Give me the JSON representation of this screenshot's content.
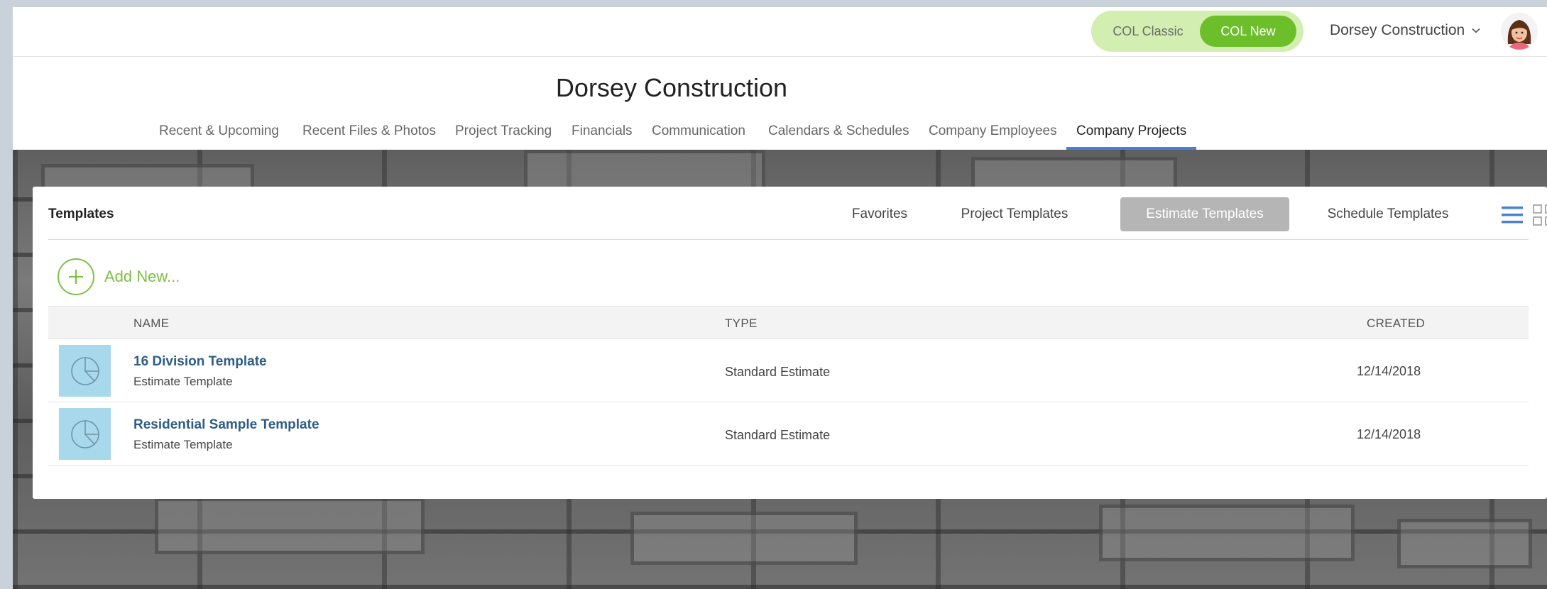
{
  "topbar": {
    "toggle": {
      "classic_label": "COL Classic",
      "new_label": "COL New",
      "selected": "COL New"
    },
    "company_menu": {
      "label": "Dorsey Construction",
      "icon": "chevron-down-icon"
    },
    "avatar_icon": "user-avatar"
  },
  "header": {
    "title": "Dorsey Construction",
    "tabs": [
      {
        "label": "Recent & Upcoming"
      },
      {
        "label": "Recent Files & Photos"
      },
      {
        "label": "Project Tracking"
      },
      {
        "label": "Financials"
      },
      {
        "label": "Communication"
      },
      {
        "label": "Calendars & Schedules"
      },
      {
        "label": "Company Employees"
      },
      {
        "label": "Company Projects"
      }
    ],
    "active_tab": "Company Projects"
  },
  "templates": {
    "title": "Templates",
    "tabs": [
      {
        "label": "Favorites"
      },
      {
        "label": "Project Templates"
      },
      {
        "label": "Estimate Templates"
      },
      {
        "label": "Schedule Templates"
      }
    ],
    "active_tab": "Estimate Templates",
    "view_icons": [
      "list-view-icon",
      "grid-view-icon"
    ],
    "add_new_label": "Add New...",
    "columns": {
      "name": "NAME",
      "type": "TYPE",
      "created": "CREATED"
    },
    "rows": [
      {
        "name": "16 Division Template",
        "subtitle": "Estimate Template",
        "type": "Standard Estimate",
        "created": "12/14/2018",
        "icon": "pie-chart-icon"
      },
      {
        "name": "Residential Sample Template",
        "subtitle": "Estimate Template",
        "type": "Standard Estimate",
        "created": "12/14/2018",
        "icon": "pie-chart-icon"
      }
    ]
  },
  "colors": {
    "accent_green": "#6cbf2a",
    "toggle_bg": "#d2eeb0",
    "nav_underline": "#4a7fd6",
    "link_blue": "#2e5c85",
    "thumb_bg": "#a7d8ec",
    "active_subtab": "#b5b5b5"
  }
}
